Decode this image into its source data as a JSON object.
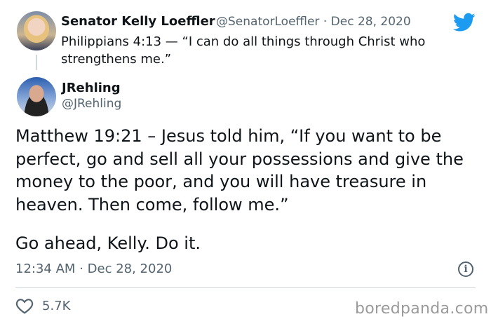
{
  "quoted_tweet": {
    "display_name": "Senator Kelly Loeffler",
    "handle": "@SenatorLoeffler",
    "separator": "·",
    "date": "Dec 28, 2020",
    "text": "Philippians 4:13 — “I can do all things through Christ who strengthens me.”"
  },
  "reply": {
    "display_name": "JRehling",
    "handle": "@JRehling",
    "text": "Matthew 19:21 – Jesus told him, “If you want to be perfect, go and sell all your possessions and give the money to the poor, and you will have treasure in heaven. Then come, follow me.”",
    "closing": "Go ahead, Kelly. Do it.",
    "time": "12:34 AM",
    "separator": "·",
    "date": "Dec 28, 2020",
    "likes": "5.7K"
  },
  "watermark": "boredpanda.com",
  "colors": {
    "twitter_blue": "#1d9bf0",
    "secondary_text": "#536471"
  }
}
